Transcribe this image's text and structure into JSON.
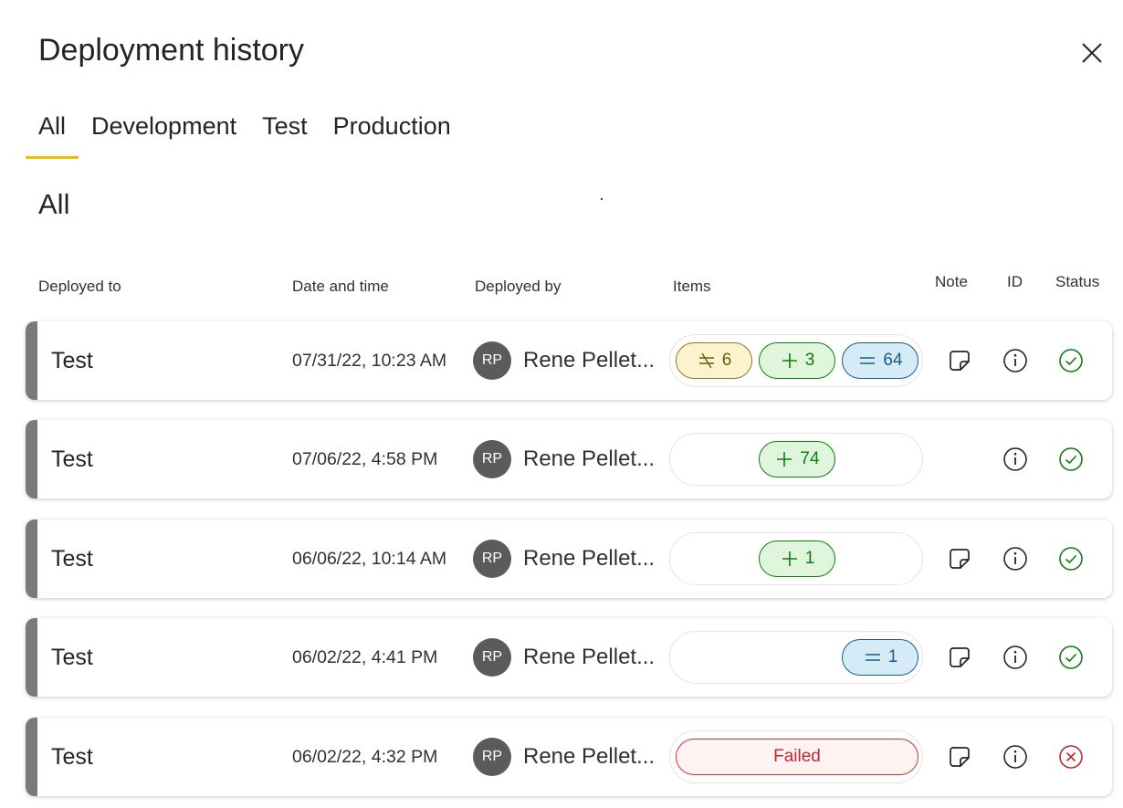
{
  "dialog": {
    "title": "Deployment history"
  },
  "tabs": [
    {
      "label": "All",
      "active": true
    },
    {
      "label": "Development",
      "active": false
    },
    {
      "label": "Test",
      "active": false
    },
    {
      "label": "Production",
      "active": false
    }
  ],
  "section_title": "All",
  "columns": {
    "deployed_to": "Deployed to",
    "date_time": "Date and time",
    "deployed_by": "Deployed by",
    "items": "Items",
    "note": "Note",
    "id": "ID",
    "status": "Status"
  },
  "colors": {
    "tab_underline": "#e8c000",
    "row_bar": "#7a7a7a",
    "success": "#107c10",
    "error": "#c4262e"
  },
  "rows": [
    {
      "env": "Test",
      "date": "07/31/22, 10:23 AM",
      "avatar": "RP",
      "by": "Rene Pellet...",
      "note": true,
      "status": "success",
      "items": [
        {
          "kind": "deleted",
          "icon": "strikethrough-equal-icon",
          "count": "6"
        },
        {
          "kind": "new",
          "icon": "plus-icon",
          "count": "3"
        },
        {
          "kind": "same",
          "icon": "equal-icon",
          "count": "64"
        }
      ]
    },
    {
      "env": "Test",
      "date": "07/06/22, 4:58 PM",
      "avatar": "RP",
      "by": "Rene Pellet...",
      "note": false,
      "status": "success",
      "items": [
        {
          "kind": "new",
          "icon": "plus-icon",
          "count": "74"
        }
      ]
    },
    {
      "env": "Test",
      "date": "06/06/22, 10:14 AM",
      "avatar": "RP",
      "by": "Rene Pellet...",
      "note": true,
      "status": "success",
      "items": [
        {
          "kind": "new",
          "icon": "plus-icon",
          "count": "1"
        }
      ]
    },
    {
      "env": "Test",
      "date": "06/02/22, 4:41 PM",
      "avatar": "RP",
      "by": "Rene Pellet...",
      "note": true,
      "status": "success",
      "items": [
        {
          "kind": "same",
          "icon": "equal-icon",
          "count": "1"
        }
      ]
    },
    {
      "env": "Test",
      "date": "06/02/22, 4:32 PM",
      "avatar": "RP",
      "by": "Rene Pellet...",
      "note": true,
      "status": "failed",
      "failed_label": "Failed",
      "items": []
    }
  ]
}
